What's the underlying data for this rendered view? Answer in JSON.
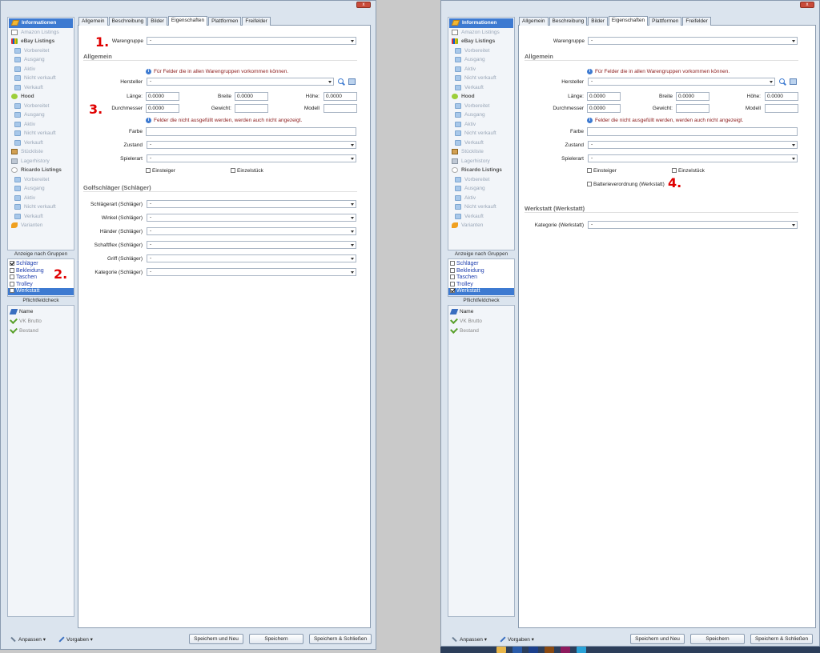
{
  "nav": [
    {
      "label": "Informationen",
      "type": "active",
      "icon": "pencil-icon"
    },
    {
      "label": "Amazon Listings",
      "type": "dim",
      "icon": "amazon-icon"
    },
    {
      "label": "eBay Listings",
      "type": "header",
      "icon": "ebay-icon"
    },
    {
      "label": "Vorbereitet",
      "type": "sub",
      "icon": "folder-icon"
    },
    {
      "label": "Ausgang",
      "type": "sub",
      "icon": "folder-icon"
    },
    {
      "label": "Aktiv",
      "type": "sub",
      "icon": "folder-icon"
    },
    {
      "label": "Nicht verkauft",
      "type": "sub",
      "icon": "folder-icon"
    },
    {
      "label": "Verkauft",
      "type": "sub",
      "icon": "folder-icon"
    },
    {
      "label": "Hood",
      "type": "header",
      "icon": "hood-icon"
    },
    {
      "label": "Vorbereitet",
      "type": "sub",
      "icon": "folder-icon"
    },
    {
      "label": "Ausgang",
      "type": "sub",
      "icon": "folder-icon"
    },
    {
      "label": "Aktiv",
      "type": "sub",
      "icon": "folder-icon"
    },
    {
      "label": "Nicht verkauft",
      "type": "sub",
      "icon": "folder-icon"
    },
    {
      "label": "Verkauft",
      "type": "sub",
      "icon": "folder-icon"
    },
    {
      "label": "Stückliste",
      "type": "dim",
      "icon": "box-icon"
    },
    {
      "label": "Lagerhistory",
      "type": "dim",
      "icon": "history-icon"
    },
    {
      "label": "Ricardo Listings",
      "type": "header",
      "icon": "ricardo-icon"
    },
    {
      "label": "Vorbereitet",
      "type": "sub",
      "icon": "folder-icon"
    },
    {
      "label": "Ausgang",
      "type": "sub",
      "icon": "folder-icon"
    },
    {
      "label": "Aktiv",
      "type": "sub",
      "icon": "folder-icon"
    },
    {
      "label": "Nicht verkauft",
      "type": "sub",
      "icon": "folder-icon"
    },
    {
      "label": "Verkauft",
      "type": "sub",
      "icon": "folder-icon"
    },
    {
      "label": "Varianten",
      "type": "dim",
      "icon": "variant-icon"
    }
  ],
  "groups_title": "Anzeige nach Gruppen",
  "pflicht_title": "Pflichtfeldcheck",
  "pflicht": [
    {
      "label": "Name",
      "icon": "blue-pencil-icon",
      "dim": false
    },
    {
      "label": "VK Brutto",
      "icon": "check-icon",
      "dim": true
    },
    {
      "label": "Bestand",
      "icon": "check-icon",
      "dim": true
    }
  ],
  "tabs": [
    "Allgemein",
    "Beschreibung",
    "Bilder",
    "Eigenschaften",
    "Plattformen",
    "Freifelder"
  ],
  "active_tab": 3,
  "form": {
    "warengruppe_label": "Warengruppe",
    "warengruppe_value": "-",
    "allgemein_title": "Allgemein",
    "info1": "Für Felder die in allen Warengruppen vorkommen können.",
    "hersteller_label": "Hersteller",
    "hersteller_value": "-",
    "laenge_label": "Länge:",
    "laenge_value": "0.0000",
    "breite_label": "Breite",
    "breite_value": "0.0000",
    "hoehe_label": "Höhe:",
    "hoehe_value": "0.0000",
    "durchmesser_label": "Durchmesser",
    "durchmesser_value": "0.0000",
    "gewicht_label": "Gewicht:",
    "gewicht_value": "",
    "modell_label": "Modell",
    "modell_value": "",
    "info2": "Felder die nicht ausgefüllt werden, werden auch nicht angezeigt.",
    "farbe_label": "Farbe",
    "zustand_label": "Zustand",
    "zustand_value": "-",
    "spielerart_label": "Spielerart",
    "spielerart_value": "-",
    "einsteiger_label": "Einsteiger",
    "einzelstueck_label": "Einzelstück",
    "batterie_label": "Batterieverordnung (Werkstatt)"
  },
  "left": {
    "groups": [
      {
        "label": "Schläger",
        "checked": true,
        "selected": false
      },
      {
        "label": "Bekleidung",
        "checked": false,
        "selected": false
      },
      {
        "label": "Taschen",
        "checked": false,
        "selected": false
      },
      {
        "label": "Trolley",
        "checked": false,
        "selected": false
      },
      {
        "label": "Werkstatt",
        "checked": false,
        "selected": true
      }
    ],
    "section_title": "Golfschläger (Schläger)",
    "fields": [
      {
        "label": "Schlägerart (Schläger)",
        "value": "-"
      },
      {
        "label": "Winkel (Schläger)",
        "value": "-"
      },
      {
        "label": "Händer (Schläger)",
        "value": "-"
      },
      {
        "label": "Schaftflex (Schläger)",
        "value": "-"
      },
      {
        "label": "Griff (Schläger)",
        "value": "-"
      },
      {
        "label": "Kategorie (Schläger)",
        "value": "-"
      }
    ],
    "markers": [
      "1.",
      "2.",
      "3."
    ]
  },
  "right": {
    "groups": [
      {
        "label": "Schläger",
        "checked": false,
        "selected": false
      },
      {
        "label": "Bekleidung",
        "checked": false,
        "selected": false
      },
      {
        "label": "Taschen",
        "checked": false,
        "selected": false
      },
      {
        "label": "Trolley",
        "checked": false,
        "selected": false
      },
      {
        "label": "Werkstatt",
        "checked": true,
        "selected": true
      }
    ],
    "section_title": "Werkstatt (Werkstatt)",
    "fields": [
      {
        "label": "Kategorie (Werkstatt)",
        "value": "-"
      }
    ],
    "markers": [
      "4."
    ]
  },
  "footer": {
    "anpassen": "Anpassen",
    "vorgaben": "Vorgaben",
    "btn_new": "Speichern und Neu",
    "btn_save": "Speichern",
    "btn_close": "Speichern & Schließen"
  },
  "close_glyph": "x",
  "dropdown_glyph": "▾",
  "colors": {
    "accent": "#3d7ad1",
    "info_text": "#8b1a1a",
    "marker": "#e00000"
  }
}
